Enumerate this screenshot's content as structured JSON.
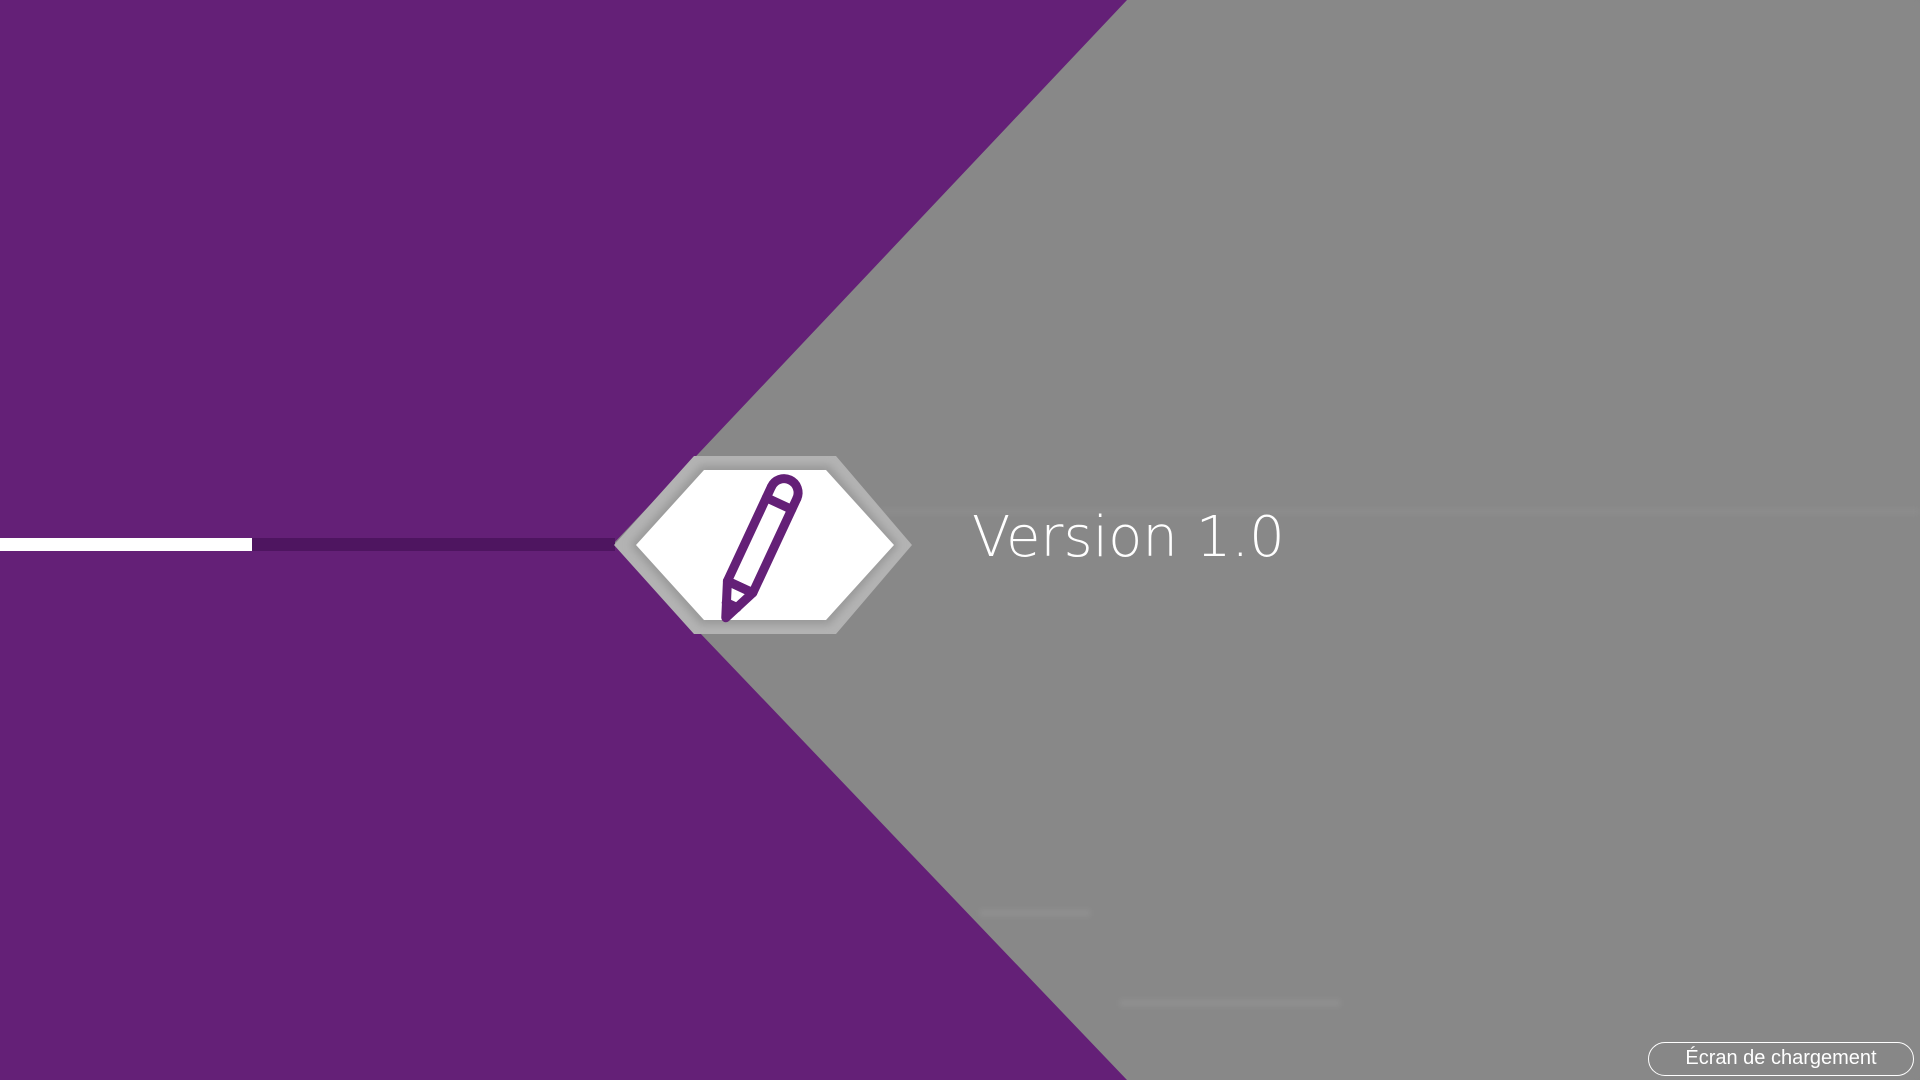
{
  "splash": {
    "version_label": "Version 1.0",
    "status_label": "Écran de chargement",
    "logo_icon": "pencil-icon",
    "progress": 0.41
  },
  "colors": {
    "brand_purple": "#642077",
    "track_purple": "#4e1560",
    "background_gray": "#878787",
    "progress_fill": "#ffffff"
  }
}
